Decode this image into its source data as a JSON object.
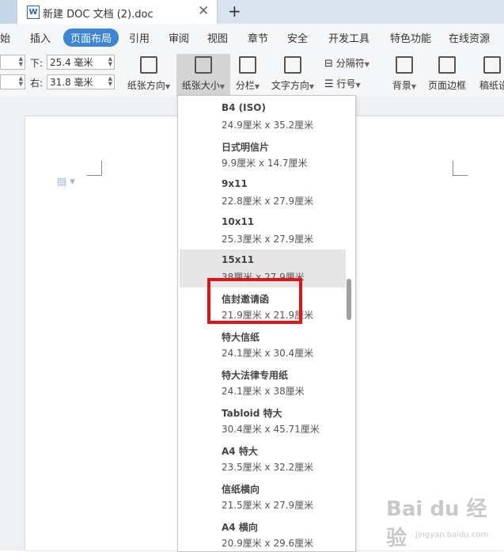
{
  "window": {
    "doc_tab_title": "新建 DOC 文档 (2).doc",
    "doc_icon": "W",
    "close_glyph": "✕",
    "new_tab_glyph": "+"
  },
  "menu": {
    "items": [
      "始",
      "插入",
      "页面布局",
      "引用",
      "审阅",
      "视图",
      "章节",
      "安全",
      "开发工具",
      "特色功能",
      "在线资源"
    ],
    "active": "页面布局"
  },
  "ribbon": {
    "margin_bottom_label": "下:",
    "margin_bottom_value": "25.4 毫米",
    "margin_right_label": "右:",
    "margin_right_value": "31.8 毫米",
    "orientation_label": "纸张方向",
    "paper_size_label": "纸张大小",
    "columns_label": "分栏",
    "text_direction_label": "文字方向",
    "separator_label": "分隔符",
    "line_number_label": "行号",
    "background_label": "背景",
    "page_border_label": "页面边框",
    "manuscript_label": "稿纸设"
  },
  "paper_sizes": [
    {
      "name": "B4 (ISO)",
      "size": "24.9厘米  x  35.2厘米"
    },
    {
      "name": "日式明信片",
      "size": "9.9厘米  x  14.7厘米"
    },
    {
      "name": "9x11",
      "size": "22.8厘米  x  27.9厘米"
    },
    {
      "name": "10x11",
      "size": "25.3厘米  x  27.9厘米"
    },
    {
      "name": "15x11",
      "size": "38厘米  x  27.9厘米"
    },
    {
      "name": "信封邀请函",
      "size": "21.9厘米  x  21.9厘米"
    },
    {
      "name": "特大信纸",
      "size": "24.1厘米  x  30.4厘米"
    },
    {
      "name": "特大法律专用纸",
      "size": "24.1厘米  x  38厘米"
    },
    {
      "name": "Tabloid 特大",
      "size": "30.4厘米  x  45.71厘米"
    },
    {
      "name": "A4 特大",
      "size": "23.5厘米  x  32.2厘米"
    },
    {
      "name": "信纸横向",
      "size": "21.5厘米  x  27.9厘米"
    },
    {
      "name": "A4 横向",
      "size": "20.9厘米  x  29.6厘米"
    }
  ],
  "hovered_item": "15x11",
  "highlighted_item": "信封邀请函",
  "colors": {
    "active_tab": "#3c86d5",
    "highlight_box": "#e01418",
    "hover_row": "#e6e6e6"
  },
  "watermark": {
    "text": "Bai du 经验",
    "sub": "jingyan.baidu.com"
  }
}
